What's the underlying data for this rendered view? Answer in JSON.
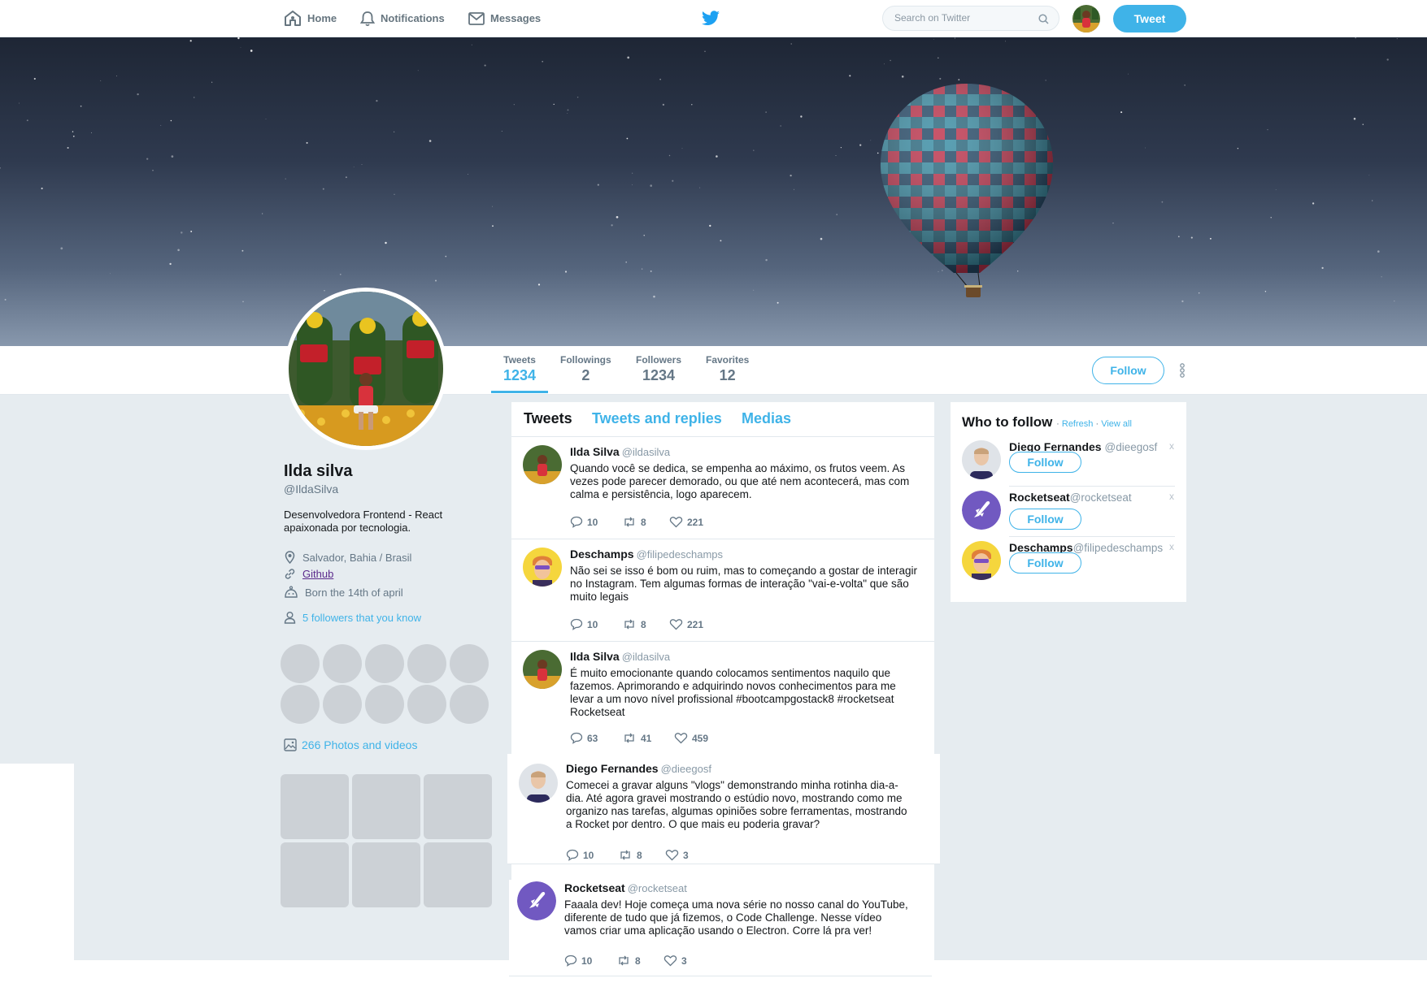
{
  "nav": {
    "home": "Home",
    "notifications": "Notifications",
    "messages": "Messages",
    "search_placeholder": "Search on Twitter",
    "tweet_button": "Tweet",
    "icons": [
      "home-icon",
      "bell-icon",
      "envelope-icon",
      "twitter-bird-icon",
      "search-icon"
    ]
  },
  "profile": {
    "name": "Ilda silva",
    "handle": "@IldaSilva",
    "bio": "Desenvolvedora Frontend - React apaixonada por tecnologia.",
    "location": "Salvador, Bahia / Brasil",
    "link": "Github",
    "birthday": "Born the 14th of april",
    "followers_you_know": "5 followers that you know",
    "photos_videos": "266 Photos and videos"
  },
  "stats": [
    {
      "label": "Tweets",
      "value": "1234"
    },
    {
      "label": "Followings",
      "value": "2"
    },
    {
      "label": "Followers",
      "value": "1234"
    },
    {
      "label": "Favorites",
      "value": "12"
    }
  ],
  "follow_button": "Follow",
  "tabs": [
    "Tweets",
    "Tweets and replies",
    "Medias"
  ],
  "tweets": [
    {
      "name": "Ilda Silva",
      "handle": "@ildasilva",
      "text": "Quando você se dedica, se empenha ao máximo, os frutos veem. As vezes pode parecer demorado, ou que até nem acontecerá, mas com calma e persistência, logo aparecem.",
      "replies": "10",
      "retweets": "8",
      "likes": "221"
    },
    {
      "name": "Deschamps",
      "handle": "@filipedeschamps",
      "text": "Não sei se isso é bom ou ruim, mas to começando a gostar de interagir no Instagram. Tem algumas formas de interação \"vai-e-volta\" que são muito legais",
      "replies": "10",
      "retweets": "8",
      "likes": "221"
    },
    {
      "name": "Ilda Silva",
      "handle": "@ildasilva",
      "text": "É muito emocionante quando colocamos sentimentos naquilo que fazemos. Aprimorando e adquirindo novos conhecimentos para me levar a um novo nível profissional #bootcampgostack8 #rocketseat Rocketseat",
      "replies": "63",
      "retweets": "41",
      "likes": "459"
    },
    {
      "name": "Diego Fernandes",
      "handle": "@dieegosf",
      "text": "Comecei a gravar alguns \"vlogs\" demonstrando minha rotinha dia-a-dia. Até agora gravei mostrando o estúdio novo, mostrando como me organizo nas tarefas, algumas opiniões sobre ferramentas, mostrando a Rocket por dentro. O que mais eu poderia gravar?",
      "replies": "10",
      "retweets": "8",
      "likes": "3"
    },
    {
      "name": "Rocketseat",
      "handle": "@rocketseat",
      "text": "Faaala dev! Hoje começa uma nova série no nosso canal do YouTube, diferente de tudo que já fizemos, o Code Challenge. Nesse vídeo vamos criar uma aplicação usando o Electron. Corre lá pra ver!",
      "replies": "10",
      "retweets": "8",
      "likes": "3"
    }
  ],
  "who_to_follow": {
    "title": "Who to follow",
    "refresh": "Refresh",
    "view_all": "View all",
    "separator": "·",
    "suggestions": [
      {
        "name": "Diego Fernandes",
        "handle": "@dieegosf",
        "follow": "Follow",
        "dismiss": "x"
      },
      {
        "name": "Rocketseat",
        "handle": "@rocketseat",
        "follow": "Follow",
        "dismiss": "x"
      },
      {
        "name": "Deschamps",
        "handle": "@filipedeschamps",
        "follow": "Follow",
        "dismiss": "x"
      }
    ]
  },
  "colors": {
    "accent": "#3fb3e8",
    "background": "#e6ecf0",
    "placeholder": "#ccd1d6"
  }
}
